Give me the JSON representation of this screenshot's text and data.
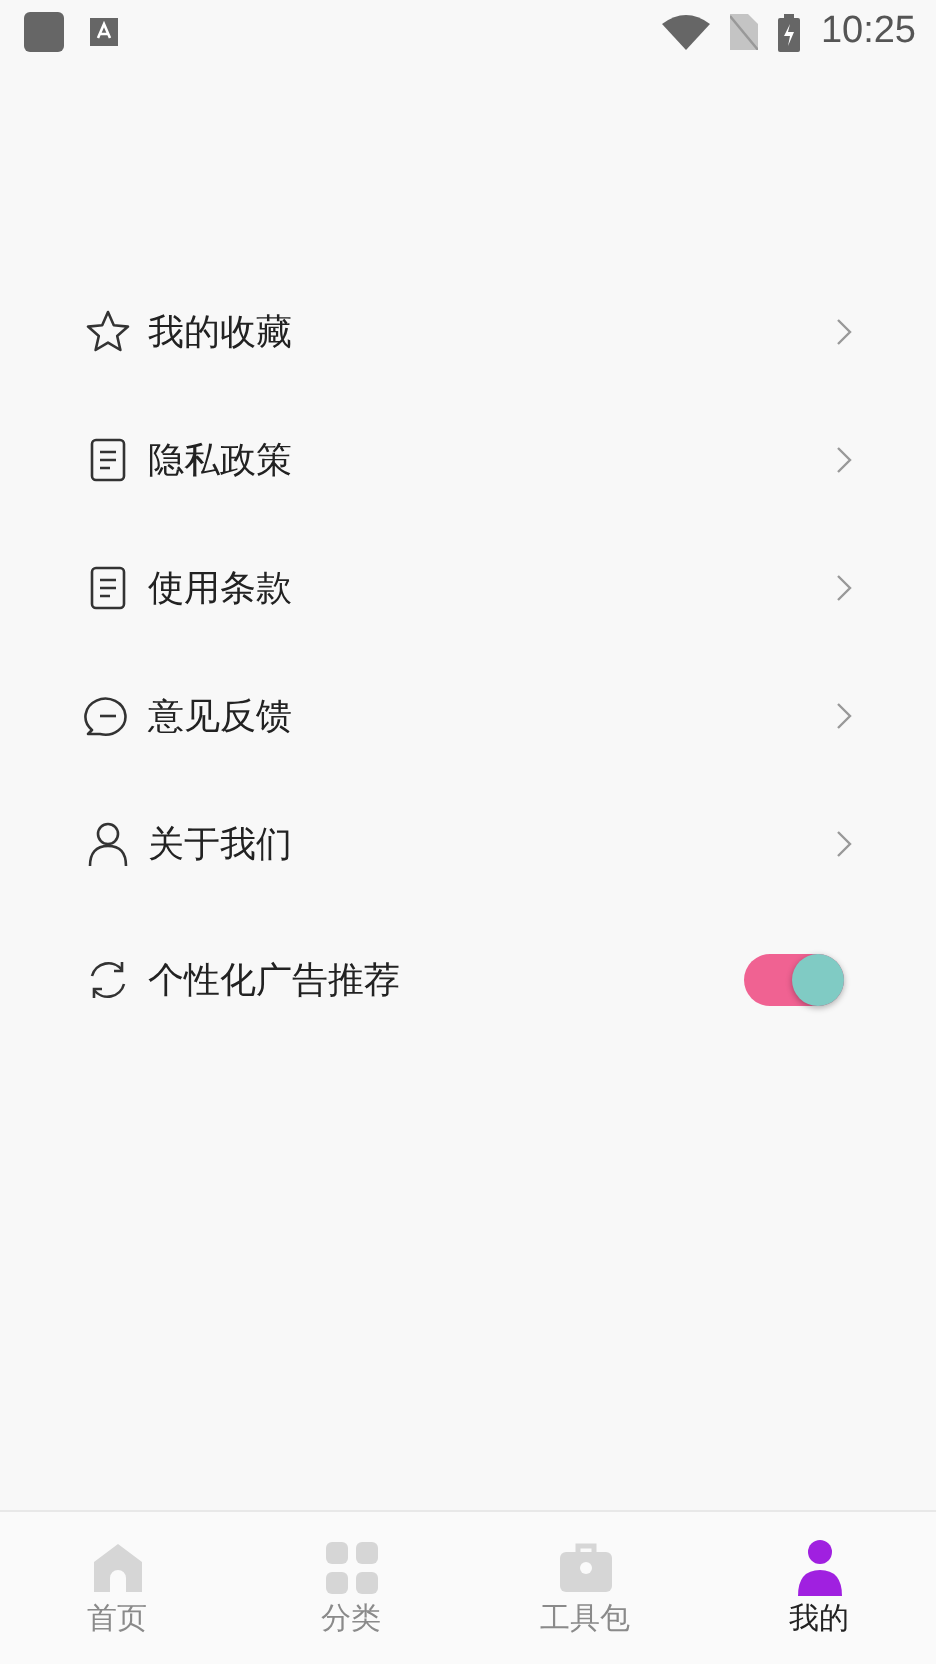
{
  "status_bar": {
    "time": "10:25"
  },
  "menu": [
    {
      "kind": "link",
      "label": "我的收藏"
    },
    {
      "kind": "link",
      "label": "隐私政策"
    },
    {
      "kind": "link",
      "label": "使用条款"
    },
    {
      "kind": "link",
      "label": "意见反馈"
    },
    {
      "kind": "link",
      "label": "关于我们"
    },
    {
      "kind": "toggle",
      "label": "个性化广告推荐",
      "on": true
    }
  ],
  "tabs": [
    {
      "label": "首页",
      "selected": false
    },
    {
      "label": "分类",
      "selected": false
    },
    {
      "label": "工具包",
      "selected": false
    },
    {
      "label": "我的",
      "selected": true
    }
  ]
}
